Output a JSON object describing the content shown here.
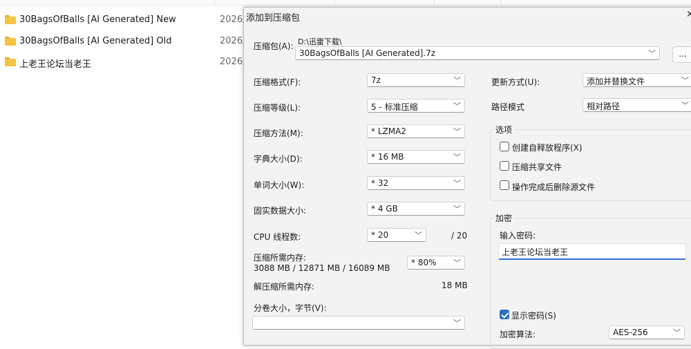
{
  "explorer": {
    "files": [
      {
        "name": "30BagsOfBalls [AI Generated] New",
        "date": "2026/"
      },
      {
        "name": "30BagsOfBalls [AI Generated] Old",
        "date": "2026/"
      },
      {
        "name": "上老王论坛当老王",
        "date": "2026/"
      }
    ]
  },
  "dialog": {
    "title": "添加到压缩包",
    "close_glyph": "✕",
    "archive": {
      "label": "压缩包(A):",
      "path": "D:\\迅雷下载\\",
      "filename": "30BagsOfBalls [AI Generated].7z",
      "browse_label": "..."
    },
    "left": {
      "format": {
        "label": "压缩格式(F):",
        "value": "7z"
      },
      "level": {
        "label": "压缩等级(L):",
        "value": "5 - 标准压缩"
      },
      "method": {
        "label": "压缩方法(M):",
        "value": "* LZMA2"
      },
      "dict": {
        "label": "字典大小(D):",
        "value": "* 16 MB"
      },
      "word": {
        "label": "单词大小(W):",
        "value": "* 32"
      },
      "solid": {
        "label": "固实数据大小:",
        "value": "* 4 GB"
      },
      "cpu": {
        "label": "CPU 线程数:",
        "value": "* 20",
        "total": "/ 20"
      },
      "mem_compress": {
        "label": "压缩所需内存:",
        "value": "3088 MB / 12871 MB / 16089 MB",
        "percent": "* 80%"
      },
      "mem_decompress": {
        "label": "解压缩所需内存:",
        "value": "18 MB"
      },
      "split": {
        "label": "分卷大小，字节(V):",
        "value": ""
      }
    },
    "right": {
      "update": {
        "label": "更新方式(U):",
        "value": "添加并替换文件"
      },
      "pathmode": {
        "label": "路径模式",
        "value": "相对路径"
      },
      "options": {
        "title": "选项",
        "sfx": {
          "label": "创建自释放程序(X)",
          "checked": false
        },
        "shared": {
          "label": "压缩共享文件",
          "checked": false
        },
        "delete": {
          "label": "操作完成后删除源文件",
          "checked": false
        }
      },
      "encryption": {
        "title": "加密",
        "password_label": "输入密码:",
        "password_value": "上老王论坛当老王",
        "show_password": {
          "label": "显示密码(S)",
          "checked": true
        },
        "algo_label": "加密算法:",
        "algo_value": "AES-256"
      }
    }
  }
}
